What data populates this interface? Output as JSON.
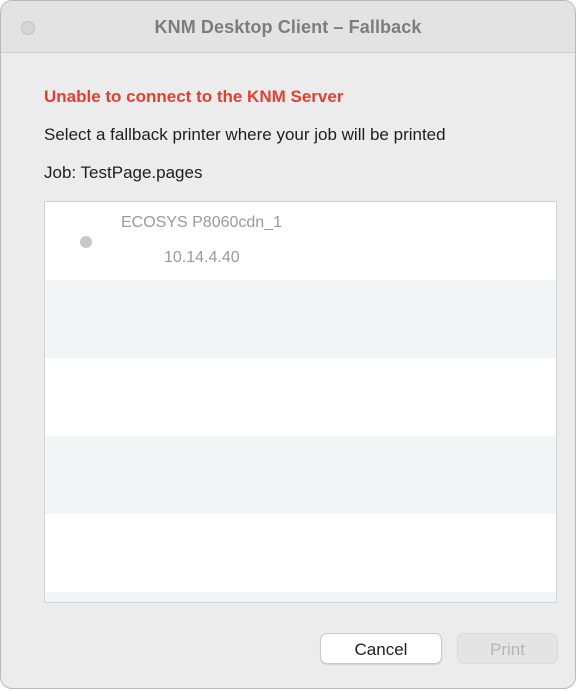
{
  "window": {
    "title": "KNM Desktop Client – Fallback"
  },
  "message": {
    "error": "Unable to connect to the KNM Server",
    "instruction": "Select a fallback printer where your job will be printed",
    "job": "Job: TestPage.pages"
  },
  "printers": [
    {
      "name": "ECOSYS P8060cdn_1",
      "ip": "10.14.4.40",
      "selected": false
    }
  ],
  "buttons": {
    "cancel": "Cancel",
    "print": "Print"
  },
  "colors": {
    "error": "#e53e2f",
    "disabled_text": "#b5b5b5"
  }
}
